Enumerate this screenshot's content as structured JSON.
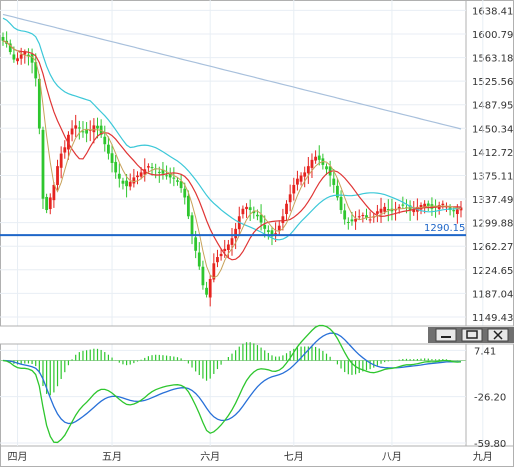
{
  "chart_data": [
    {
      "type": "candlestick",
      "title": "",
      "xlabel": "",
      "ylabel": "",
      "ylim": [
        1135,
        1655
      ],
      "y_ticks": [
        "1638.41",
        "1600.79",
        "1563.18",
        "1525.56",
        "1487.95",
        "1450.34",
        "1412.72",
        "1375.11",
        "1337.49",
        "1299.88",
        "1262.27",
        "1224.65",
        "1187.04",
        "1149.43"
      ],
      "x_ticks": [
        "四月",
        "五月",
        "六月",
        "七月",
        "八月",
        "九月"
      ],
      "x_tick_index": [
        4,
        30,
        57,
        80,
        107,
        132
      ],
      "hline": {
        "value": 1280,
        "label": "1290.15"
      },
      "grid": true,
      "colors": {
        "up": "#e52420",
        "down": "#2ec62e",
        "hline": "#1e66c8",
        "ma_short": "#c8a25a",
        "ma_mid": "#e03535",
        "ma_long": "#3cc8d8",
        "ma_vlong": "#a8c0dc"
      },
      "closes": [
        1590,
        1585,
        1572,
        1560,
        1562,
        1568,
        1572,
        1565,
        1555,
        1530,
        1450,
        1338,
        1320,
        1340,
        1360,
        1390,
        1410,
        1420,
        1440,
        1450,
        1455,
        1450,
        1445,
        1442,
        1448,
        1455,
        1450,
        1440,
        1425,
        1410,
        1395,
        1380,
        1370,
        1362,
        1358,
        1365,
        1372,
        1375,
        1380,
        1385,
        1390,
        1388,
        1385,
        1380,
        1378,
        1375,
        1372,
        1370,
        1365,
        1355,
        1340,
        1310,
        1280,
        1255,
        1230,
        1200,
        1185,
        1210,
        1235,
        1245,
        1250,
        1258,
        1265,
        1275,
        1290,
        1310,
        1322,
        1325,
        1320,
        1315,
        1310,
        1300,
        1290,
        1285,
        1278,
        1283,
        1295,
        1310,
        1330,
        1345,
        1360,
        1370,
        1375,
        1380,
        1390,
        1400,
        1405,
        1400,
        1392,
        1385,
        1375,
        1360,
        1340,
        1320,
        1305,
        1300,
        1302,
        1306,
        1310,
        1312,
        1308,
        1305,
        1310,
        1318,
        1322,
        1325,
        1320,
        1318,
        1321,
        1325,
        1327,
        1324,
        1320,
        1322,
        1325,
        1328,
        1330,
        1326,
        1322,
        1325,
        1328,
        1330,
        1326,
        1320,
        1318,
        1321,
        1324
      ],
      "ma_series": [
        {
          "key": "ma_short"
        },
        {
          "key": "ma_mid"
        },
        {
          "key": "ma_long"
        },
        {
          "key": "ma_vlong"
        }
      ]
    },
    {
      "type": "macd",
      "title": "",
      "ylim": [
        -62,
        12
      ],
      "y_ticks": [
        "7.41",
        "-26.20",
        "-59.80"
      ],
      "colors": {
        "hist": "#2ec62e",
        "dif": "#2ec62e",
        "dea": "#2870d8",
        "zero": "#9ad09a"
      }
    }
  ],
  "pane_controls": {
    "minimize_icon": "minimize-icon",
    "restore_icon": "restore-icon",
    "close_icon": "close-icon"
  }
}
